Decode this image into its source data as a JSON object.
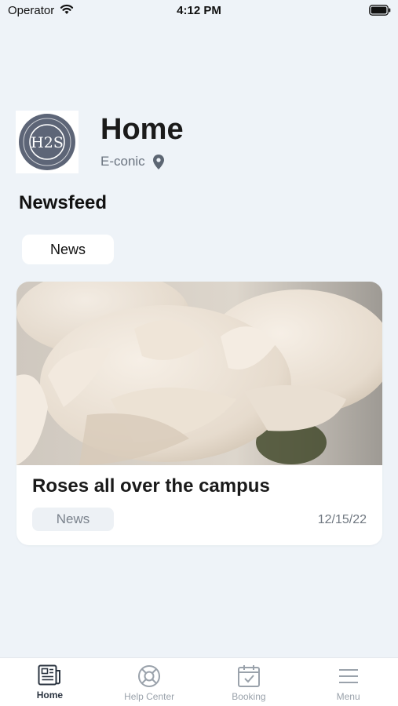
{
  "status_bar": {
    "carrier": "Operator",
    "time": "4:12 PM"
  },
  "header": {
    "logo_text": "H2S",
    "title": "Home",
    "location": "E-conic",
    "pin_icon": "location-pin-icon"
  },
  "newsfeed": {
    "section_title": "Newsfeed",
    "filter_chip": "News"
  },
  "card": {
    "title": "Roses all over the campus",
    "tag": "News",
    "date": "12/15/22"
  },
  "tabs": [
    {
      "label": "Home",
      "icon": "newspaper-icon",
      "active": true
    },
    {
      "label": "Help Center",
      "icon": "lifebuoy-icon",
      "active": false
    },
    {
      "label": "Booking",
      "icon": "calendar-check-icon",
      "active": false
    },
    {
      "label": "Menu",
      "icon": "hamburger-menu-icon",
      "active": false
    }
  ],
  "colors": {
    "background": "#eef3f8",
    "logo_circle": "#5d6577",
    "inactive": "#9aa2ab",
    "active": "#2b3440"
  }
}
